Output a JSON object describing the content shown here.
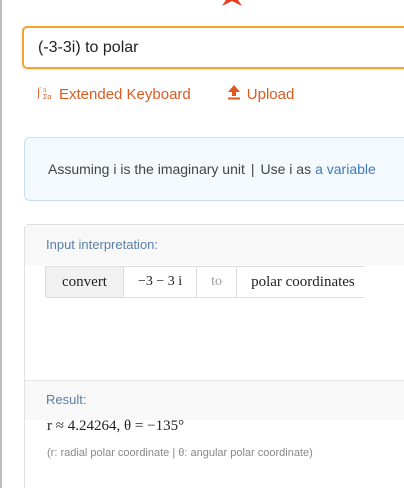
{
  "search": {
    "value": "(-3-3i) to polar"
  },
  "toolbar": {
    "extended_keyboard_label": "Extended Keyboard",
    "upload_label": "Upload",
    "icons": [
      "keyboard-math-icon",
      "upload-arrow-icon"
    ],
    "accent_color": "#dd5a1f"
  },
  "assumption": {
    "text": "Assuming i is the imaginary unit",
    "separator": "|",
    "alt_text": "Use i as",
    "alt_link": "a variable"
  },
  "input_pod": {
    "title": "Input interpretation:",
    "cells": [
      "convert",
      "−3 − 3 i",
      "to",
      "polar coordinates"
    ]
  },
  "result_pod": {
    "title": "Result:",
    "value": "r ≈ 4.24264,   θ = −135°",
    "note": "(r: radial polar coordinate | θ: angular polar coordinate)"
  }
}
